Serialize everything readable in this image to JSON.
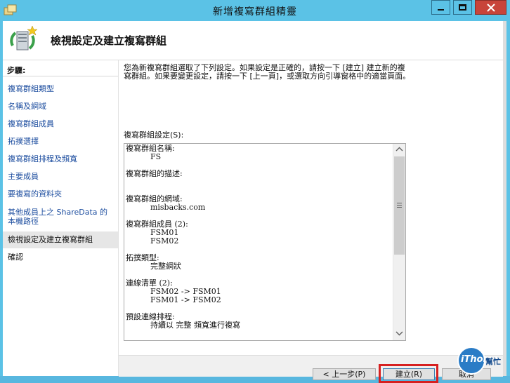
{
  "window": {
    "title": "新增複寫群組精靈"
  },
  "header": {
    "title": "檢視設定及建立複寫群組"
  },
  "sidebar": {
    "heading": "步驟:",
    "items": [
      {
        "label": "複寫群組類型"
      },
      {
        "label": "名稱及網域"
      },
      {
        "label": "複寫群組成員"
      },
      {
        "label": "拓撲選擇"
      },
      {
        "label": "複寫群組排程及頻寬"
      },
      {
        "label": "主要成員"
      },
      {
        "label": "要複寫的資料夾"
      },
      {
        "label": "其他成員上之 ShareData 的本機路徑"
      },
      {
        "label": "檢視設定及建立複寫群組"
      },
      {
        "label": "確認"
      }
    ]
  },
  "main": {
    "intro": "您為新複寫群組選取了下列設定。如果設定是正確的，請按一下 [建立] 建立新的複寫群組。如果要變更設定，請按一下 [上一頁]，或選取方向引導窗格中的適當頁面。",
    "settings_label": "複寫群組設定(S):",
    "settings_text": "複寫群組名稱:\n          FS\n\n複寫群組的描述:\n\n\n複寫群組的網域:\n          misbacks.com\n\n複寫群組成員 (2):\n          FSM01\n          FSM02\n\n拓撲類型:\n          完整網狀\n\n連線清單 (2):\n          FSM02 -> FSM01\n          FSM01 -> FSM02\n\n預設連線排程:\n          持續以 完整 頻寬進行複寫"
  },
  "buttons": {
    "back": "< 上一步(P)",
    "create": "建立(R)",
    "cancel": "取消"
  },
  "watermark": {
    "logo": "iThome",
    "side": "幫忙"
  },
  "colors": {
    "titlebar": "#5bc2e6",
    "link": "#1f4fa0",
    "highlight_box": "#d62020",
    "close_button": "#c8443a"
  }
}
